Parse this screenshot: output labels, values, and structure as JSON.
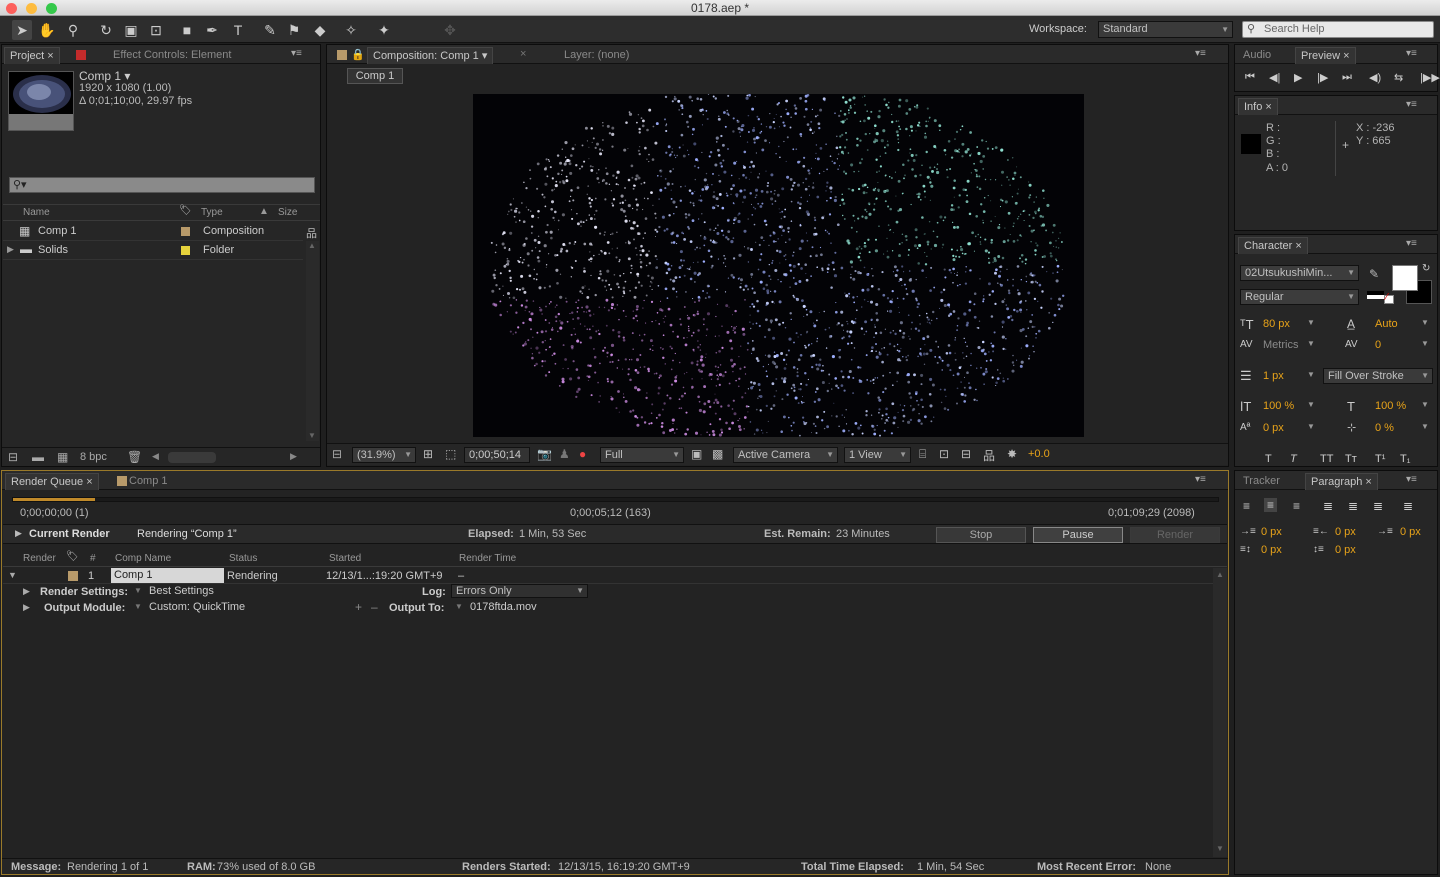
{
  "window": {
    "title": "0178.aep *"
  },
  "toolbar": {
    "workspace_label": "Workspace:",
    "workspace_value": "Standard",
    "search_placeholder": "Search Help"
  },
  "project": {
    "tab": "Project",
    "effect_tab": "Effect Controls: Element",
    "comp_name": "Comp 1 ▾",
    "comp_dims": "1920 x 1080 (1.00)",
    "comp_duration": "Δ 0;01;10;00, 29.97 fps",
    "columns": {
      "name": "Name",
      "type": "Type",
      "size": "Size"
    },
    "items": [
      {
        "name": "Comp 1",
        "type": "Composition",
        "color": "#b89a6a"
      },
      {
        "name": "Solids",
        "type": "Folder",
        "color": "#e6d23c"
      }
    ],
    "bpc": "8 bpc"
  },
  "composition": {
    "tab": "Composition: Comp 1",
    "layer_tab": "Layer: (none)",
    "breadcrumb": "Comp 1",
    "zoom": "(31.9%)",
    "timecode": "0;00;50;14",
    "resolution": "Full",
    "camera": "Active Camera",
    "views": "1 View",
    "exposure": "+0.0"
  },
  "preview": {
    "audio_tab": "Audio",
    "preview_tab": "Preview"
  },
  "info": {
    "tab": "Info",
    "r": "R :",
    "g": "G :",
    "b": "B :",
    "a": "A : 0",
    "x": "X : -236",
    "y": "Y : 665"
  },
  "character": {
    "tab": "Character",
    "font": "02UtsukushiMin...",
    "style": "Regular",
    "size": "80 px",
    "leading": "Auto",
    "kerning": "Metrics",
    "tracking": "0",
    "stroke": "1 px",
    "stroke_type": "Fill Over Stroke",
    "vscale": "100 %",
    "hscale": "100 %",
    "baseline": "0 px",
    "tsume": "0 %"
  },
  "paragraph": {
    "tracker_tab": "Tracker",
    "paragraph_tab": "Paragraph",
    "indent1": "0 px",
    "indent2": "0 px",
    "indent3": "0 px",
    "space1": "0 px",
    "space2": "0 px"
  },
  "render_queue": {
    "tab": "Render Queue",
    "comp_tab": "Comp 1",
    "time_start": "0;00;00;00 (1)",
    "time_current": "0;00;05;12 (163)",
    "time_end": "0;01;09;29 (2098)",
    "progress": 0.068,
    "current_render_label": "Current Render",
    "rendering_label": "Rendering “Comp 1”",
    "elapsed_label": "Elapsed:",
    "elapsed_value": "1 Min, 53 Sec",
    "remain_label": "Est. Remain:",
    "remain_value": "23 Minutes",
    "stop": "Stop",
    "pause": "Pause",
    "render": "Render",
    "columns": {
      "render": "Render",
      "num": "#",
      "comp_name": "Comp Name",
      "status": "Status",
      "started": "Started",
      "render_time": "Render Time"
    },
    "row": {
      "num": "1",
      "comp": "Comp 1",
      "status": "Rendering",
      "started": "12/13/1...:19:20 GMT+9",
      "render_time": "–"
    },
    "render_settings_label": "Render Settings:",
    "render_settings_value": "Best Settings",
    "log_label": "Log:",
    "log_value": "Errors Only",
    "output_module_label": "Output Module:",
    "output_module_value": "Custom: QuickTime",
    "output_to_label": "Output To:",
    "output_to_value": "0178ftda.mov"
  },
  "status": {
    "message_label": "Message:",
    "message": "Rendering 1 of 1",
    "ram_label": "RAM:",
    "ram": "73% used of 8.0 GB",
    "started_label": "Renders Started:",
    "started": "12/13/15, 16:19:20 GMT+9",
    "total_label": "Total Time Elapsed:",
    "total": "1 Min, 54 Sec",
    "error_label": "Most Recent Error:",
    "error": "None"
  }
}
